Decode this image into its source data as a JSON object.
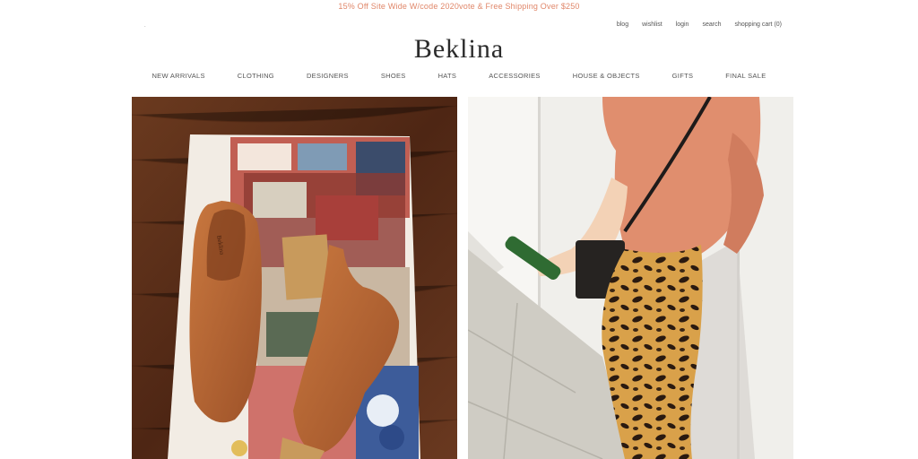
{
  "promo": {
    "text": "15% Off Site Wide W/code 2020vote & Free Shipping Over $250"
  },
  "utility_nav": {
    "blog": "blog",
    "wishlist": "wishlist",
    "login": "login",
    "search": "search",
    "cart": "shopping cart (0)"
  },
  "brand": {
    "logo": "Beklina"
  },
  "main_nav": [
    "NEW ARRIVALS",
    "CLOTHING",
    "DESIGNERS",
    "SHOES",
    "HATS",
    "ACCESSORIES",
    "HOUSE & OBJECTS",
    "GIFTS",
    "FINAL SALE"
  ],
  "hero_left": {
    "shoe_brand_stamp": "Beklina"
  },
  "colors": {
    "promo": "#e0876a",
    "wood": "#5a2e18",
    "leather": "#b8683a",
    "sweater": "#e08e6e",
    "leopard_base": "#d9a14a"
  }
}
